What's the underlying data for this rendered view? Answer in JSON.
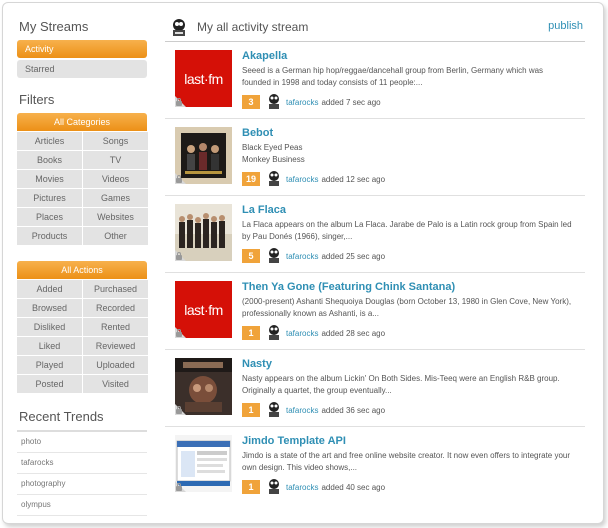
{
  "sidebar": {
    "streams_heading": "My Streams",
    "streams": [
      {
        "label": "Activity",
        "active": true
      },
      {
        "label": "Starred",
        "active": false
      }
    ],
    "filters_heading": "Filters",
    "categories_heading": "All Categories",
    "categories": [
      "Articles",
      "Songs",
      "Books",
      "TV",
      "Movies",
      "Videos",
      "Pictures",
      "Games",
      "Places",
      "Websites",
      "Products",
      "Other"
    ],
    "actions_heading": "All Actions",
    "actions": [
      "Added",
      "Purchased",
      "Browsed",
      "Recorded",
      "Disliked",
      "Rented",
      "Liked",
      "Reviewed",
      "Played",
      "Uploaded",
      "Posted",
      "Visited"
    ],
    "trends_heading": "Recent Trends",
    "trends": [
      "photo",
      "tafarocks",
      "photography",
      "olympus"
    ]
  },
  "main": {
    "title": "My all activity stream",
    "publish_label": "publish",
    "items": [
      {
        "title": "Akapella",
        "desc": "Seeed is a German hip hop/reggae/dancehall group from Berlin, Germany which was founded in 1998 and today consists of 11 people:...",
        "count": "3",
        "user": "tafarocks",
        "action": "added 7 sec ago",
        "thumb": "lastfm"
      },
      {
        "title": "Bebot",
        "desc": "Black Eyed Peas\nMonkey Business",
        "count": "19",
        "user": "tafarocks",
        "action": "added 12 sec ago",
        "thumb": "album-bep"
      },
      {
        "title": "La Flaca",
        "desc": "La Flaca appears on the album La Flaca. Jarabe de Palo is a Latin rock group from Spain led by Pau Donés (1966), singer,...",
        "count": "5",
        "user": "tafarocks",
        "action": "added 25 sec ago",
        "thumb": "album-band"
      },
      {
        "title": "Then Ya Gone (Featuring Chink Santana)",
        "desc": "(2000-present) Ashanti Shequoiya Douglas (born October 13, 1980 in Glen Cove, New York), professionally known as Ashanti, is a...",
        "count": "1",
        "user": "tafarocks",
        "action": "added 28 sec ago",
        "thumb": "lastfm"
      },
      {
        "title": "Nasty",
        "desc": "Nasty appears on the album Lickin' On Both Sides. Mis-Teeq were an English R&B group. Originally a quartet, the group eventually...",
        "count": "1",
        "user": "tafarocks",
        "action": "added 36 sec ago",
        "thumb": "album-misteeq"
      },
      {
        "title": "Jimdo Template API",
        "desc": "Jimdo is a state of the art and free online website creator. It now even offers to integrate your own design. This video shows,...",
        "count": "1",
        "user": "tafarocks",
        "action": "added 40 sec ago",
        "thumb": "screenshot"
      }
    ]
  },
  "lastfm_logo": "last·fm",
  "colors": {
    "accent": "#ec9016",
    "link": "#2f8fb4",
    "lastfm": "#d51007"
  }
}
